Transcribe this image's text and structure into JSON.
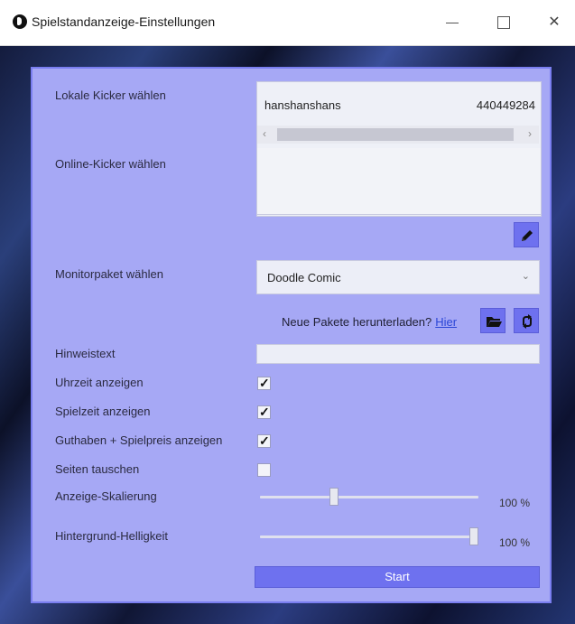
{
  "window": {
    "title": "Spielstandanzeige-Einstellungen"
  },
  "labels": {
    "local_kicker": "Lokale Kicker wählen",
    "online_kicker": "Online-Kicker wählen",
    "monitor_package": "Monitorpaket wählen",
    "hint_text": "Hinweistext",
    "show_time": "Uhrzeit anzeigen",
    "show_playtime": "Spielzeit anzeigen",
    "show_credit": "Guthaben + Spielpreis anzeigen",
    "swap_sides": "Seiten tauschen",
    "display_scaling": "Anzeige-Skalierung",
    "background_brightness": "Hintergrund-Helligkeit"
  },
  "local_kicker_list": {
    "items": [
      {
        "name": "hanshanshans",
        "id": "440449284"
      }
    ],
    "scroll_left": "‹",
    "scroll_right": "›"
  },
  "monitor_package": {
    "selected": "Doodle Comic",
    "chevron": "⌄"
  },
  "download": {
    "question": "Neue Pakete herunterladen?",
    "link_text": "Hier"
  },
  "hint_text": {
    "value": ""
  },
  "checkboxes": {
    "show_time": true,
    "show_playtime": true,
    "show_credit": true,
    "swap_sides": false,
    "tick": "✓"
  },
  "sliders": {
    "display_scaling": {
      "value_label": "100 %",
      "position": 0.33
    },
    "background_brightness": {
      "value_label": "100 %",
      "position": 1.0
    }
  },
  "start_button": {
    "label": "Start"
  },
  "icons": {
    "app": "app-logo-icon",
    "edit": "pencil-icon",
    "folder": "folder-icon",
    "refresh": "refresh-icon"
  },
  "colors": {
    "panel": "#a6a8f5",
    "accent": "#6e71ef",
    "link": "#2b46d6"
  }
}
